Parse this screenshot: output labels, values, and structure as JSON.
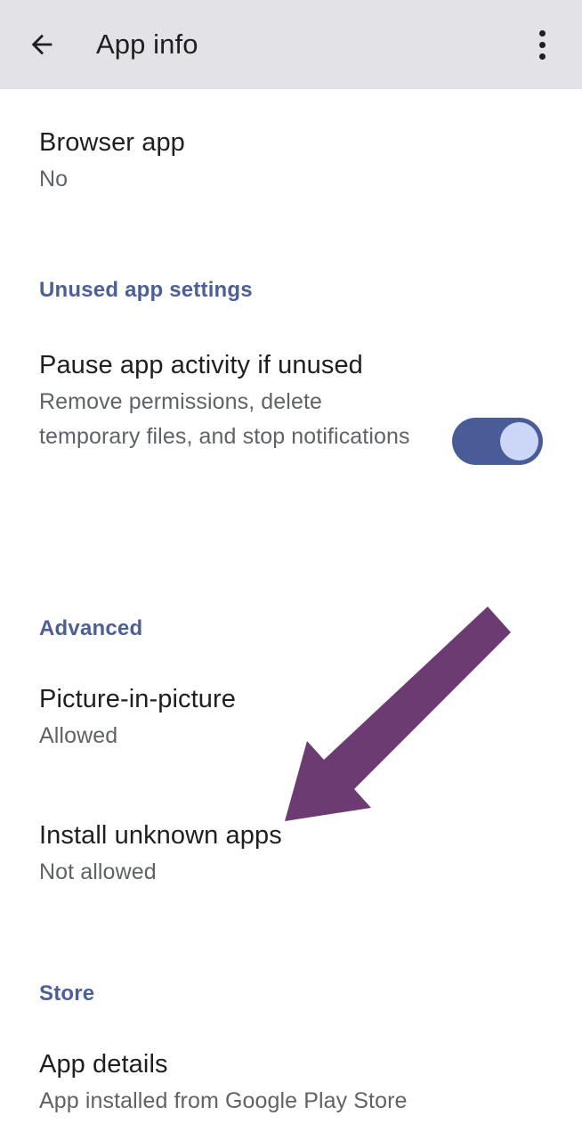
{
  "appbar": {
    "back_icon": "arrow-left-icon",
    "title": "App info",
    "overflow_icon": "more-vertical-icon"
  },
  "colors": {
    "appbar_background": "#e3e2e6",
    "page_background": "#ffffff",
    "section_header": "#4c5f96",
    "primary_text": "#1f1f1f",
    "secondary_text": "#5f6368",
    "switch_track_on": "#4a5c97",
    "switch_thumb_on": "#ccd6f6",
    "annotation_arrow": "#6b3b72"
  },
  "rows": {
    "browser_app": {
      "title": "Browser app",
      "value": "No"
    },
    "pause_app_activity": {
      "title": "Pause app activity if unused",
      "description": "Remove permissions, delete temporary files, and stop notifications",
      "switch_state": "on"
    },
    "picture_in_picture": {
      "title": "Picture-in-picture",
      "value": "Allowed"
    },
    "install_unknown_apps": {
      "title": "Install unknown apps",
      "value": "Not allowed"
    },
    "app_details": {
      "title": "App details",
      "value": "App installed from Google Play Store"
    }
  },
  "sections": {
    "unused_app_settings": "Unused app settings",
    "advanced": "Advanced",
    "store": "Store"
  },
  "annotation": {
    "name": "arrow-pointing-to-install-unknown-apps"
  }
}
